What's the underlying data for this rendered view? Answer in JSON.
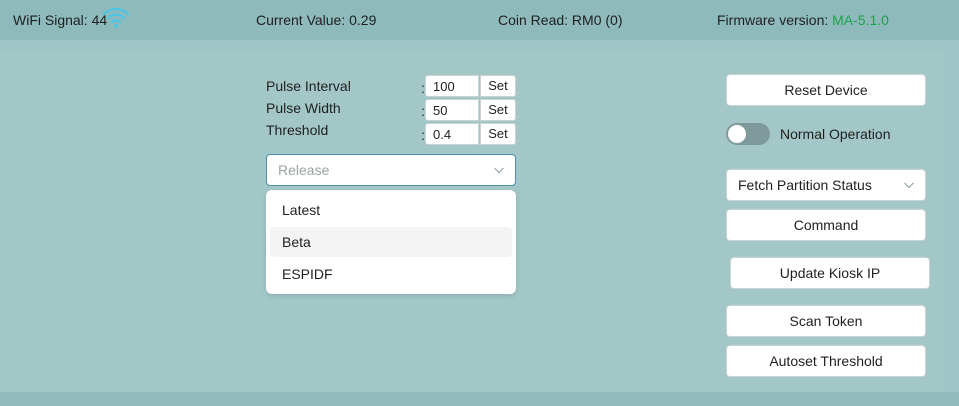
{
  "status_bar": {
    "wifi_label": "WiFi Signal: 44",
    "current_value": "Current Value: 0.29",
    "coin_read": "Coin Read: RM0 (0)",
    "firmware_label": "Firmware version: ",
    "firmware_value": "MA-5.1.0"
  },
  "settings": [
    {
      "label": "Pulse Interval",
      "colon": ":",
      "value": "100",
      "button": "Set"
    },
    {
      "label": "Pulse Width",
      "colon": ":",
      "value": "50",
      "button": "Set"
    },
    {
      "label": "Threshold",
      "colon": ":",
      "value": "0.4",
      "button": "Set"
    }
  ],
  "release_select": {
    "placeholder": "Release",
    "options": [
      "Latest",
      "Beta",
      "ESPIDF"
    ],
    "highlighted": "Beta"
  },
  "right_panel": {
    "reset_button": "Reset Device",
    "toggle_label": "Normal Operation",
    "toggle_on": false,
    "partition_select": "Fetch Partition Status",
    "command_button": "Command",
    "update_ip_button": "Update Kiosk IP",
    "scan_token_button": "Scan Token",
    "autoset_button": "Autoset Threshold"
  },
  "colors": {
    "background": "#a3c7c7",
    "topbar": "#8fbabb",
    "firmware_green": "#1aa34a",
    "wifi_icon": "#4fc4e6",
    "select_focus_border": "#4c8fb0"
  },
  "icons": [
    "wifi-icon",
    "chevron-down-icon"
  ]
}
